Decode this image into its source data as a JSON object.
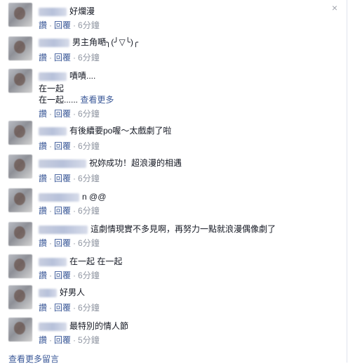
{
  "close_icon": "×",
  "meta": {
    "like": "讚",
    "reply": "回覆",
    "sep": "·"
  },
  "comments": [
    {
      "text": "好爛漫",
      "time": "6分鐘"
    },
    {
      "text": "男主角嗮╮(╯▽╰)╭",
      "time": "6分鐘"
    },
    {
      "text": "嘖嘖....",
      "line2": "在一起",
      "line3": "在一起......",
      "see_more": "查看更多",
      "time": "6分鐘"
    },
    {
      "text": "有後續要po喔～太戲劇了啦",
      "time": "6分鐘"
    },
    {
      "text": "祝妳成功！超浪漫的相遇",
      "time": "6分鐘"
    },
    {
      "text": "n @@",
      "time": "6分鐘"
    },
    {
      "text": "這劇情現實不多見啊，再努力一點就浪漫偶像劇了",
      "time": "6分鐘"
    },
    {
      "text": "在一起 在一起",
      "time": "6分鐘"
    },
    {
      "text": "好男人",
      "time": "6分鐘"
    },
    {
      "text": "最特別的情人節",
      "time": "5分鐘"
    }
  ],
  "footer": "查看更多留言"
}
